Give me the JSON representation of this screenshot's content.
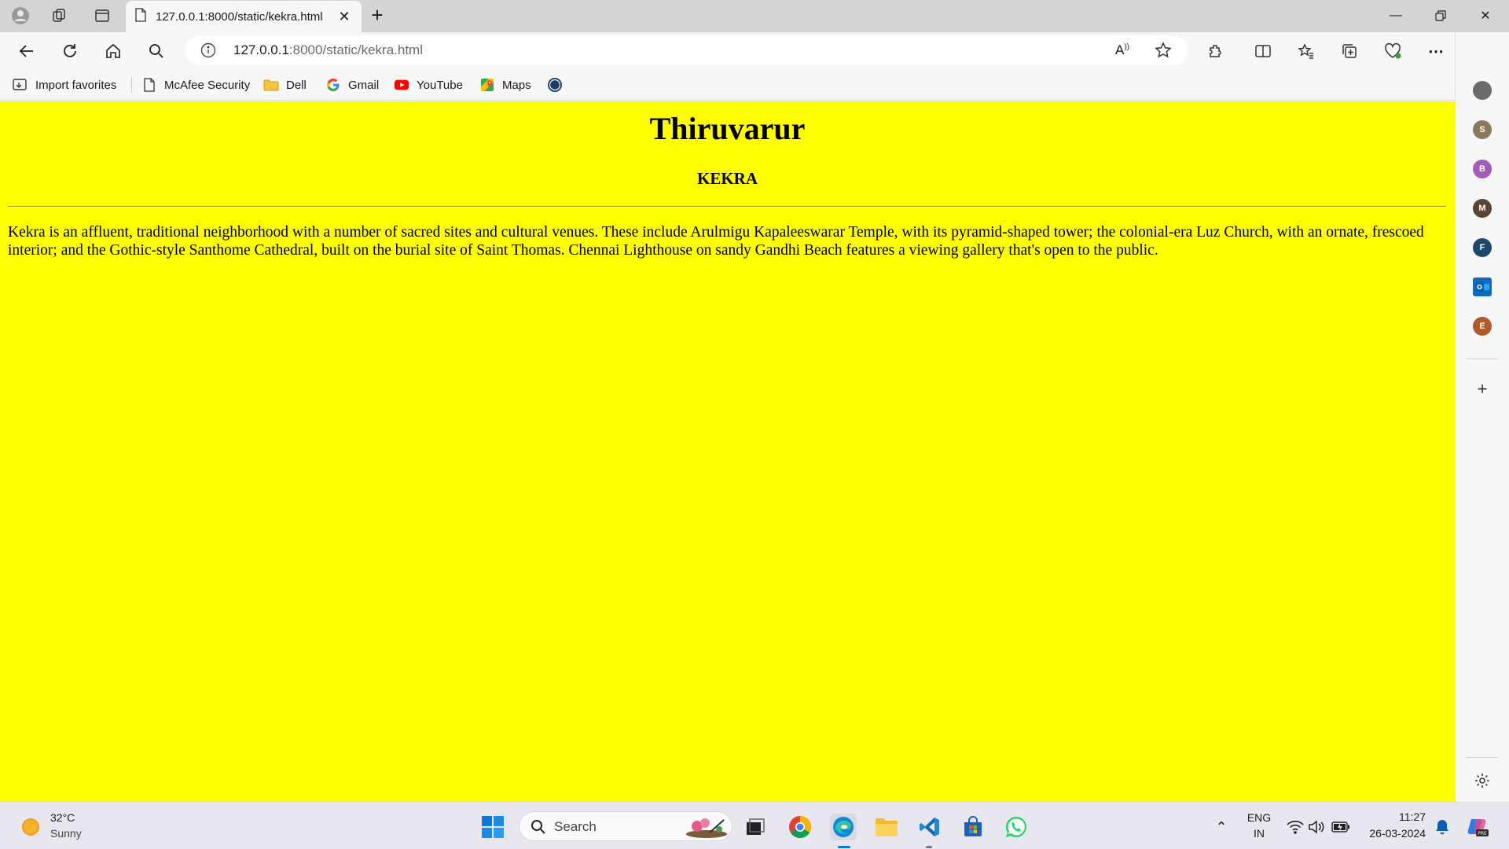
{
  "browser": {
    "tab_title": "127.0.0.1:8000/static/kekra.html",
    "url_host": "127.0.0.1",
    "url_path": ":8000/static/kekra.html"
  },
  "favorites": [
    {
      "label": "Import favorites",
      "icon": "import-icon"
    },
    {
      "label": "McAfee Security",
      "icon": "page-icon"
    },
    {
      "label": "Dell",
      "icon": "folder-icon"
    },
    {
      "label": "Gmail",
      "icon": "google-icon"
    },
    {
      "label": "YouTube",
      "icon": "youtube-icon"
    },
    {
      "label": "Maps",
      "icon": "maps-icon"
    }
  ],
  "page": {
    "title": "Thiruvarur",
    "subtitle": "KEKRA",
    "body": "Kekra is an affluent, traditional neighborhood with a number of sacred sites and cultural venues. These include Arulmigu Kapaleeswarar Temple, with its pyramid-shaped tower; the colonial-era Luz Church, with an ornate, frescoed interior; and the Gothic-style Santhome Cathedral, built on the burial site of Saint Thomas. Chennai Lighthouse on sandy Gandhi Beach features a viewing gallery that's open to the public.",
    "background_color": "#ffff00"
  },
  "sidebar": {
    "items": [
      {
        "letter": "",
        "color": "#6b6b6b"
      },
      {
        "letter": "S",
        "color": "#8a7a5a"
      },
      {
        "letter": "B",
        "color": "#a35bb8"
      },
      {
        "letter": "M",
        "color": "#5a4530"
      },
      {
        "letter": "F",
        "color": "#1d4a6b"
      },
      {
        "letter": "",
        "color": "#0f6cbd"
      },
      {
        "letter": "E",
        "color": "#b25a2a"
      }
    ]
  },
  "taskbar": {
    "weather_temp": "32°C",
    "weather_cond": "Sunny",
    "search_label": "Search",
    "lang_top": "ENG",
    "lang_bottom": "IN",
    "time": "11:27",
    "date": "26-03-2024"
  }
}
